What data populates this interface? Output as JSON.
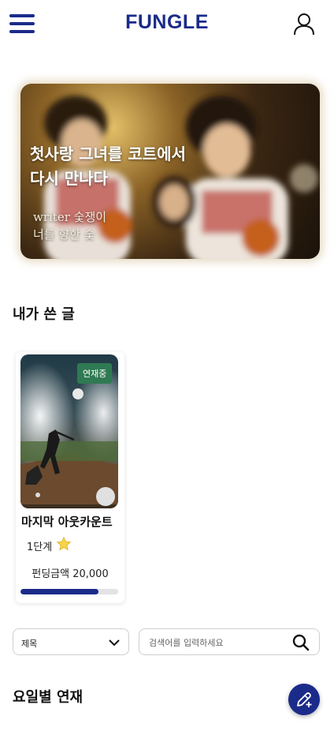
{
  "header": {
    "logo": "FUNGLE",
    "menu_icon": "hamburger-menu-icon",
    "profile_icon": "user-profile-icon"
  },
  "banner": {
    "title": "첫사랑 그녀를 코트에서\n다시 만나다",
    "writer": "writer 숯쟁이",
    "tagline": "너를 향한 숯"
  },
  "my_posts": {
    "section_title": "내가 쓴 글",
    "cards": [
      {
        "badge": "연재중",
        "title": "마지막 아웃카운트",
        "level": "1단계",
        "level_icon": "star-icon",
        "funding": "펀딩금액 20,000",
        "progress": 0.8
      }
    ]
  },
  "filter": {
    "select_value": "제목",
    "search_placeholder": "검색어를 입력하세요"
  },
  "weekly": {
    "section_title": "요일별 연재"
  },
  "fab_icon": "write-pen-icon",
  "colors": {
    "brand": "#1b2b8a",
    "badge": "#2f7a52",
    "progress_track": "#e3e3e6"
  }
}
